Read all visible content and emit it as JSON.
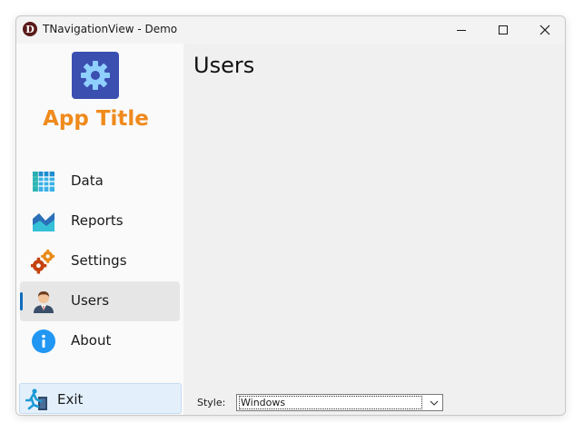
{
  "window": {
    "title": "TNavigationView - Demo",
    "app_icon_letter": "D"
  },
  "sidebar": {
    "app_title": "App Title",
    "items": [
      {
        "label": "Data",
        "icon": "data-grid-icon"
      },
      {
        "label": "Reports",
        "icon": "area-chart-icon"
      },
      {
        "label": "Settings",
        "icon": "gears-icon"
      },
      {
        "label": "Users",
        "icon": "user-icon",
        "selected": true
      },
      {
        "label": "About",
        "icon": "info-icon"
      }
    ],
    "footer": {
      "label": "Exit",
      "icon": "exit-run-icon"
    }
  },
  "content": {
    "page_title": "Users",
    "style_label": "Style:",
    "style_value": "Windows"
  },
  "colors": {
    "accent": "#0f6cbd",
    "app_title": "#ef8a1c",
    "logo_bg": "#3b4fb0",
    "selected_bg": "#e6e6e6",
    "exit_bg": "#e3f0fb"
  }
}
